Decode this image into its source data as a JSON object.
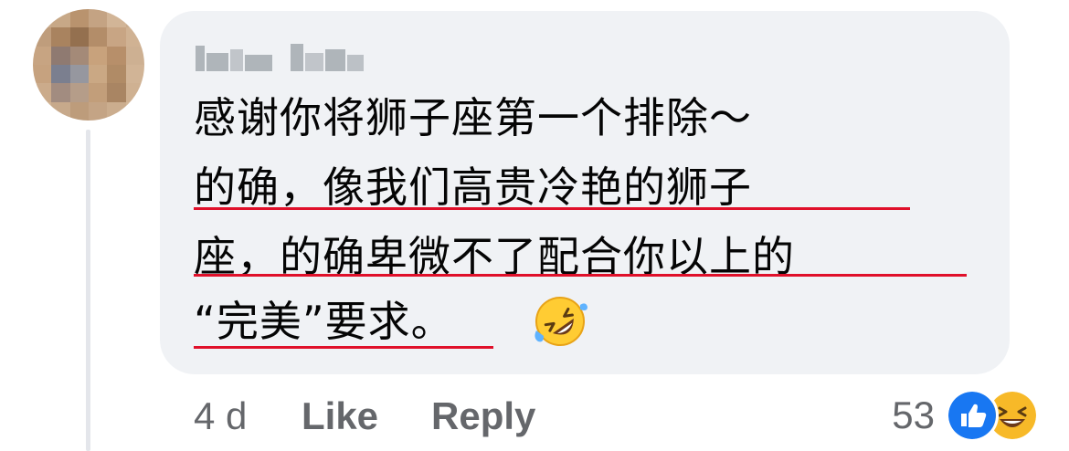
{
  "comment": {
    "author_name_redacted": "",
    "lines": [
      "感谢你将狮子座第一个排除～",
      "的确，像我们高贵冷艳的狮子",
      "座，的确卑微不了配合你以上的",
      "“完美”要求。"
    ],
    "emoji": "rolling-on-floor-laughing-icon"
  },
  "actions": {
    "timestamp": "4 d",
    "like_label": "Like",
    "reply_label": "Reply"
  },
  "reactions": {
    "count": "53",
    "types": [
      "like",
      "haha"
    ]
  },
  "colors": {
    "bubble": "#f0f2f5",
    "text": "#050505",
    "meta": "#65676b",
    "underline": "#e0102a",
    "like_blue": "#1877f2",
    "haha_yellow": "#f7b928"
  }
}
